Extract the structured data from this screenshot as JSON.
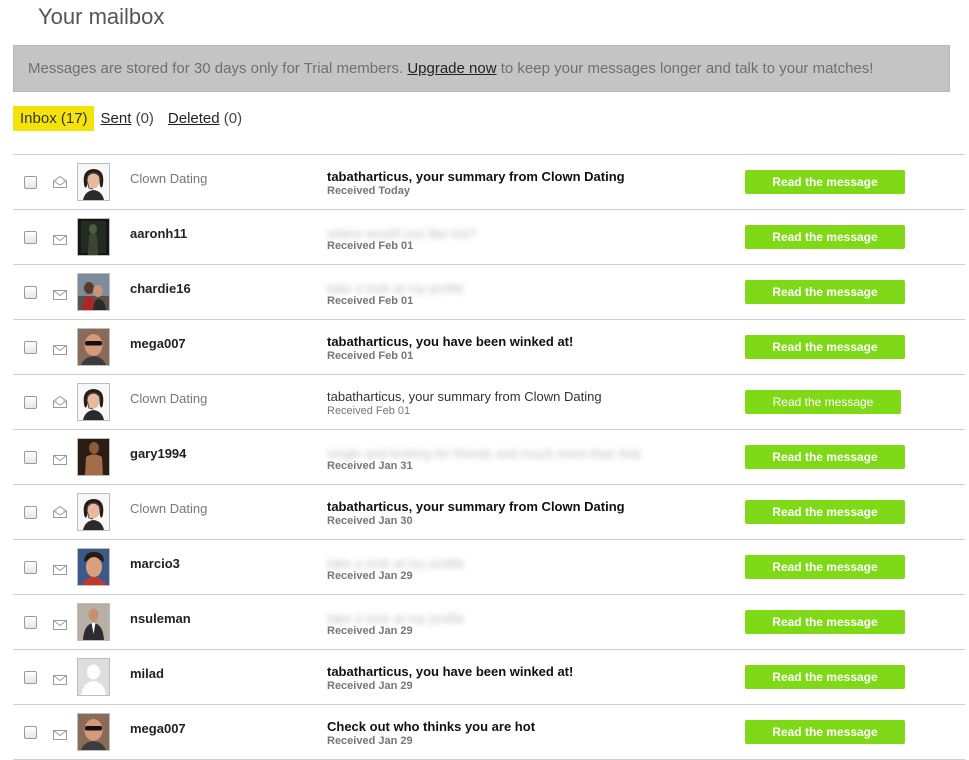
{
  "page": {
    "title": "Your mailbox"
  },
  "notice": {
    "text_before": "Messages are stored for 30 days only for Trial members. ",
    "link_label": "Upgrade now",
    "text_after": " to keep your messages longer and talk to your matches!"
  },
  "tabs": {
    "inbox": {
      "label": "Inbox (17)"
    },
    "sent": {
      "label": "Sent",
      "count": " (0)"
    },
    "deleted": {
      "label": "Deleted",
      "count": " (0)"
    }
  },
  "colors": {
    "accent_yellow": "#f5e20a",
    "button_green": "#7fd916",
    "notice_bg": "#c4c4c4"
  },
  "messages": [
    {
      "sender": "Clown Dating",
      "subject": "tabatharticus, your summary from Clown Dating",
      "date": "Received Today",
      "button": "Read the message",
      "state": "opened",
      "avatar": "woman-headset"
    },
    {
      "sender": "aaronh11",
      "subject": "where would you like me?",
      "date": "Received Feb 01",
      "button": "Read the message",
      "state": "unread",
      "blurred": true,
      "avatar": "dark-photo"
    },
    {
      "sender": "chardie16",
      "subject": "take a look at my profile",
      "date": "Received Feb 01",
      "button": "Read the message",
      "state": "unread",
      "blurred": true,
      "avatar": "couple-photo"
    },
    {
      "sender": "mega007",
      "subject": "tabatharticus, you have been winked at!",
      "date": "Received Feb 01",
      "button": "Read the message",
      "state": "unread",
      "avatar": "man-sunglasses"
    },
    {
      "sender": "Clown Dating",
      "subject": "tabatharticus, your summary from Clown Dating",
      "date": "Received Feb 01",
      "button": "Read the message",
      "state": "read",
      "avatar": "woman-headset"
    },
    {
      "sender": "gary1994",
      "subject": "single and looking for friends and much more than that",
      "date": "Received Jan 31",
      "button": "Read the message",
      "state": "unread",
      "blurred": true,
      "avatar": "shirtless-photo"
    },
    {
      "sender": "Clown Dating",
      "subject": "tabatharticus, your summary from Clown Dating",
      "date": "Received Jan 30",
      "button": "Read the message",
      "state": "opened",
      "avatar": "woman-headset"
    },
    {
      "sender": "marcio3",
      "subject": "take a look at my profile",
      "date": "Received Jan 29",
      "button": "Read the message",
      "state": "unread",
      "blurred": true,
      "avatar": "man-face"
    },
    {
      "sender": "nsuleman",
      "subject": "take a look at my profile",
      "date": "Received Jan 29",
      "button": "Read the message",
      "state": "unread",
      "blurred": true,
      "avatar": "man-suit"
    },
    {
      "sender": "milad",
      "subject": "tabatharticus, you have been winked at!",
      "date": "Received Jan 29",
      "button": "Read the message",
      "state": "unread",
      "avatar": "placeholder"
    },
    {
      "sender": "mega007",
      "subject": "Check out who thinks you are hot",
      "date": "Received Jan 29",
      "button": "Read the message",
      "state": "unread",
      "avatar": "man-sunglasses"
    }
  ]
}
